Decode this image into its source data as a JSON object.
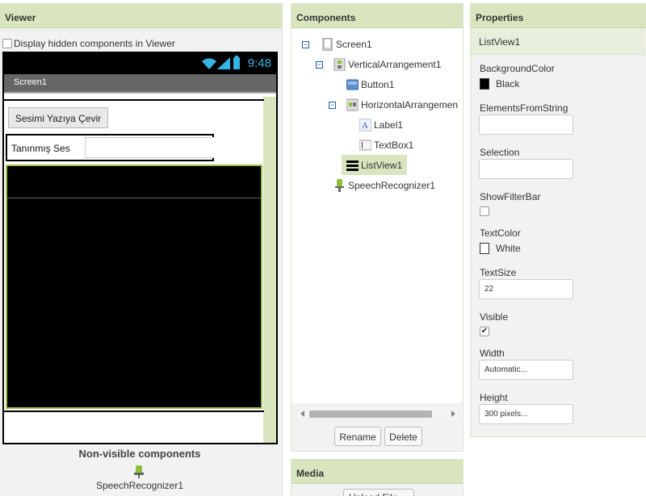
{
  "viewer": {
    "title": "Viewer",
    "hidden_toggle_label": "Display hidden components in Viewer",
    "status_time": "9:48",
    "screen_title": "Screen1",
    "button_label": "Sesimi Yazıya Çevir",
    "label1_text": "Tanınmış Ses",
    "textbox1_value": "",
    "nonvisible_title": "Non-visible components",
    "nonvisible_items": [
      "SpeechRecognizer1"
    ]
  },
  "components": {
    "title": "Components",
    "tree": [
      {
        "name": "Screen1",
        "icon": "screen-icon",
        "toggle": "−"
      },
      {
        "name": "VerticalArrangement1",
        "icon": "vertical-arrangement-icon",
        "toggle": "−"
      },
      {
        "name": "Button1",
        "icon": "button-icon"
      },
      {
        "name": "HorizontalArrangemen",
        "icon": "horizontal-arrangement-icon",
        "toggle": "−"
      },
      {
        "name": "Label1",
        "icon": "label-icon"
      },
      {
        "name": "TextBox1",
        "icon": "textbox-icon"
      },
      {
        "name": "ListView1",
        "icon": "listview-icon",
        "selected": true
      },
      {
        "name": "SpeechRecognizer1",
        "icon": "microphone-icon"
      }
    ],
    "rename_label": "Rename",
    "delete_label": "Delete"
  },
  "media": {
    "title": "Media",
    "upload_label": "Upload File ..."
  },
  "properties": {
    "title": "Properties",
    "selected_component": "ListView1",
    "background_color_label": "BackgroundColor",
    "background_color_value": "Black",
    "elements_from_string_label": "ElementsFromString",
    "elements_from_string_value": "",
    "selection_label": "Selection",
    "selection_value": "",
    "show_filter_bar_label": "ShowFilterBar",
    "show_filter_bar_checked": false,
    "text_color_label": "TextColor",
    "text_color_value": "White",
    "text_size_label": "TextSize",
    "text_size_value": "22",
    "visible_label": "Visible",
    "visible_checked": true,
    "width_label": "Width",
    "width_value": "Automatic...",
    "height_label": "Height",
    "height_value": "300 pixels..."
  },
  "colors": {
    "panel_header": "#d8e5bf",
    "selection": "#d8e5bf",
    "status_accent": "#33b5e5",
    "listview_border": "#9bc24a"
  }
}
